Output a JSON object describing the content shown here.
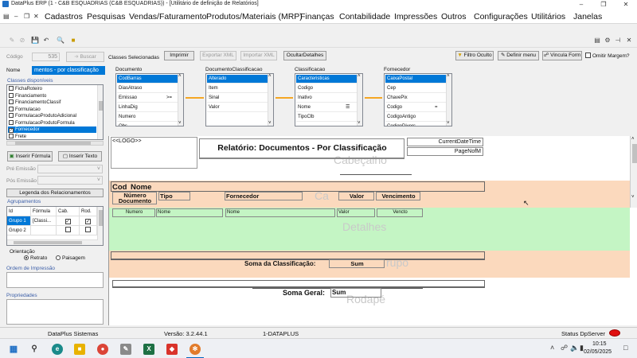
{
  "window": {
    "title": "DataPlus ERP (1 - C&B ESQUADRIAS  (C&B ESQUADRIAS)) - [Utilitário de definição de Relatórios]"
  },
  "menubar": {
    "items": [
      "Cadastros",
      "Pesquisas",
      "Vendas/Faturamento",
      "Produtos/Materiais (MRP)",
      "Finanças",
      "Contabilidade",
      "Impressões",
      "Outros",
      "Configurações",
      "Utilitários",
      "Janelas"
    ]
  },
  "form": {
    "codigo_label": "Código",
    "codigo_value": "535",
    "buscar_label": "Buscar",
    "nome_label": "Nome",
    "nome_value": "mentos - por classificação",
    "classes_selecionadas_label": "Classes Selecionadas",
    "imprimir_label": "Imprimir",
    "exportar_xml_label": "Exportar XML",
    "importar_xml_label": "Importar XML",
    "ocultar_detalhes_label": "OcultarDetalhes",
    "filtro_oculto_label": "Filtro Oculto",
    "definir_menu_label": "Definir menu",
    "vincula_form_label": "Vincula Form",
    "omitir_margem_label": "Omitir Margem?"
  },
  "classes_disponiveis": {
    "label": "Classes disponíveis",
    "items": [
      {
        "label": "FichaRoteiro",
        "checked": false
      },
      {
        "label": "Financiamento",
        "checked": false
      },
      {
        "label": "FinanciamentoClassif",
        "checked": false
      },
      {
        "label": "Formulacao",
        "checked": false
      },
      {
        "label": "FormulacaoProdutoAdicional",
        "checked": false
      },
      {
        "label": "FormulacaoProdutoFormula",
        "checked": false
      },
      {
        "label": "Fornecedor",
        "checked": true
      },
      {
        "label": "Frete",
        "checked": false
      }
    ]
  },
  "left_panel": {
    "inserir_formula_label": "Inserir Fórmula",
    "inserir_texto_label": "Inserir Texto",
    "pre_emissao_label": "Pré Emissão",
    "pos_emissao_label": "Pós Emissão",
    "legenda_label": "Legenda dos Relacionamentos",
    "agrupamentos_label": "Agrupamentos",
    "grid_headers": [
      "Id",
      "Fórmula",
      "Cab.",
      "Rod."
    ],
    "grid_rows": [
      {
        "id": "Grupo 1",
        "formula": "[Classi...",
        "cab": true,
        "rod": true
      },
      {
        "id": "Grupo 2",
        "formula": "",
        "cab": false,
        "rod": false
      }
    ],
    "orientacao_label": "Orientação",
    "retrato_label": "Retrato",
    "paisagem_label": "Paisagem",
    "orientacao_value": "Retrato",
    "ordem_impressao_label": "Ordem de Impressão",
    "propriedades_label": "Propriedades"
  },
  "class_tables": [
    {
      "title": "Documento",
      "fields": [
        {
          "name": "CodBarras",
          "marker": ""
        },
        {
          "name": "DiasAtraso",
          "marker": ""
        },
        {
          "name": "Emissao",
          "marker": ">="
        },
        {
          "name": "LinhaDig",
          "marker": ""
        },
        {
          "name": "Numero",
          "marker": ""
        },
        {
          "name": "Obs",
          "marker": ""
        }
      ],
      "selected": 0
    },
    {
      "title": "DocumentoClassificacao",
      "fields": [
        {
          "name": "Alterado",
          "marker": ""
        },
        {
          "name": "Item",
          "marker": ""
        },
        {
          "name": "Sinal",
          "marker": ""
        },
        {
          "name": "Valor",
          "marker": ""
        }
      ],
      "selected": 0
    },
    {
      "title": "Classificacao",
      "fields": [
        {
          "name": "Caracteristicas",
          "marker": ""
        },
        {
          "name": "Codigo",
          "marker": ""
        },
        {
          "name": "Inativo",
          "marker": ""
        },
        {
          "name": "Nome",
          "marker": "list"
        },
        {
          "name": "TipoClb",
          "marker": ""
        }
      ],
      "selected": 0
    },
    {
      "title": "Fornecedor",
      "fields": [
        {
          "name": "CaixaPostal",
          "marker": ""
        },
        {
          "name": "Cep",
          "marker": ""
        },
        {
          "name": "ChavePix",
          "marker": ""
        },
        {
          "name": "Codigo",
          "marker": "="
        },
        {
          "name": "CodigoAntigo",
          "marker": ""
        },
        {
          "name": "CodigoDivers",
          "marker": ""
        }
      ],
      "selected": 0
    }
  ],
  "report": {
    "logo_text": "<<LOGO>>",
    "title": "Relatório: Documentos - Por Classificação",
    "current_datetime": "CurrentDateTime",
    "page_nof_m": "PageNofM",
    "band_cabecalho": "Cabeçalho",
    "band_grupo_cab": "Ca",
    "band_detalhes": "Detalhes",
    "band_grupo_rod": "rupo",
    "band_rodape": "Rodapé",
    "group_cod": "Cod",
    "group_nome": "Nome",
    "col_headers": {
      "numero": "Número Documento",
      "tipo": "Tipo",
      "fornecedor": "Fornecedor",
      "valor": "Valor",
      "vencimento": "Vencimento"
    },
    "detail_fields": [
      "Numero",
      "Nome",
      "Nome",
      "Valor",
      "Vencto"
    ],
    "soma_classificacao": "Soma da Classificação:",
    "soma_label": "Sum",
    "soma_geral": "Soma Geral:",
    "soma_geral_value": "Sum"
  },
  "statusbar": {
    "app": "DataPlus Sistemas",
    "version": "Versão: 3.2.44.1",
    "company": "1-DATAPLUS",
    "status_dp": "Status DpServer"
  },
  "taskbar": {
    "time": "10:15",
    "date": "02/05/2025"
  }
}
